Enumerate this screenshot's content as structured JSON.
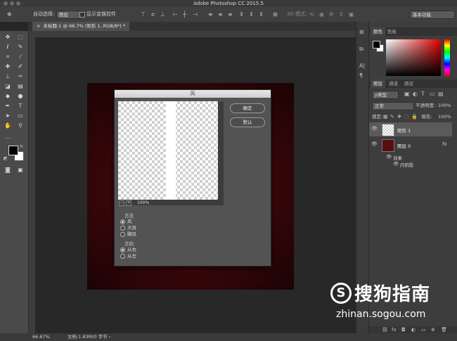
{
  "app": {
    "title": "Adobe Photoshop CC 2015.5"
  },
  "options_bar": {
    "auto_select_label": "自动选择:",
    "auto_select_value": "图层",
    "show_transform_label": "显示变换控件",
    "mode_3d_label": "3D 模式:",
    "workspace_value": "基本功能"
  },
  "document_tab": {
    "label": "未标题-1 @ 66.7% (矩形 1, RGB/8*) *"
  },
  "status_bar": {
    "zoom": "66.67%",
    "doc_info": "文档:1.83M/0 字节"
  },
  "color_panel": {
    "tabs": [
      "颜色",
      "色板"
    ]
  },
  "layers_panel": {
    "tabs": [
      "图层",
      "通道",
      "路径"
    ],
    "filter_kind": "ρ类型",
    "blend_mode": "正常",
    "opacity_label": "不透明度:",
    "opacity_value": "100%",
    "lock_label": "锁定:",
    "fill_label": "填充:",
    "fill_value": "100%",
    "layers": [
      {
        "name": "矩形 1"
      },
      {
        "name": "图层 0",
        "fx": "fx"
      }
    ],
    "effects_label": "效果",
    "effect_item": "内阴影"
  },
  "wind_dialog": {
    "title": "风",
    "ok_label": "确定",
    "default_label": "默认",
    "zoom_value": "100%",
    "method_label": "方法",
    "method_options": [
      "风",
      "大风",
      "飓风"
    ],
    "method_selected": "风",
    "direction_label": "方向",
    "direction_options": [
      "从右",
      "从左"
    ],
    "direction_selected": "从右"
  },
  "watermark": {
    "brand": "搜狗指南",
    "url": "zhinan.sogou.com"
  },
  "colors": {
    "accent_red": "#4a0d10",
    "panel_bg": "#3d3d3d",
    "dialog_bg": "#535353"
  }
}
